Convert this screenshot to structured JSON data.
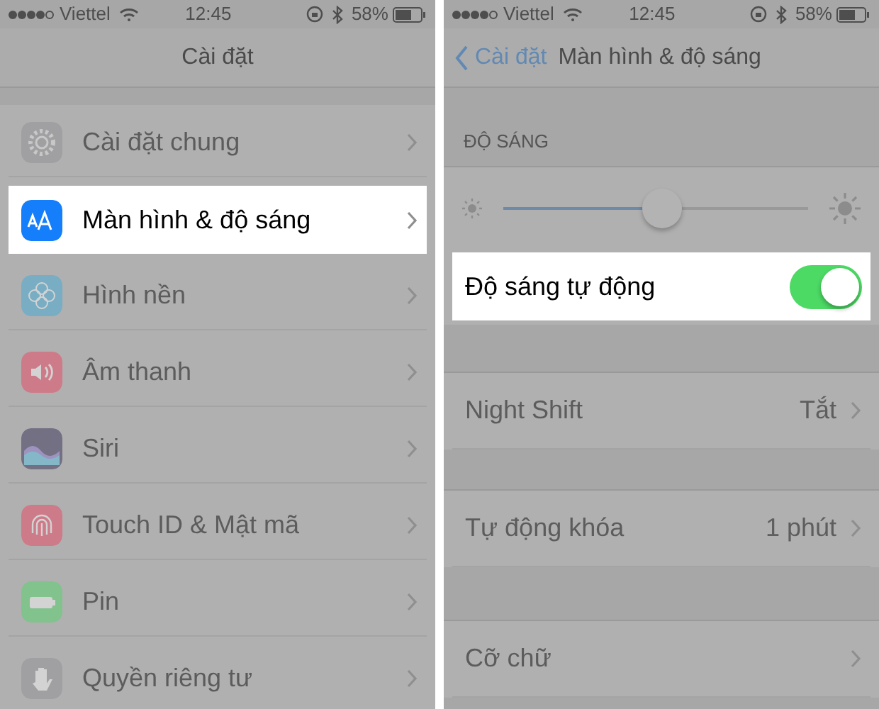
{
  "left": {
    "status_bar": {
      "carrier": "Viettel",
      "time": "12:45",
      "battery": "58%"
    },
    "title": "Cài đặt",
    "items": [
      {
        "label": "Cài đặt chung",
        "highlighted": false
      },
      {
        "label": "Màn hình & độ sáng",
        "highlighted": true
      },
      {
        "label": "Hình nền",
        "highlighted": false
      },
      {
        "label": "Âm thanh",
        "highlighted": false
      },
      {
        "label": "Siri",
        "highlighted": false
      },
      {
        "label": "Touch ID & Mật mã",
        "highlighted": false
      },
      {
        "label": "Pin",
        "highlighted": false
      },
      {
        "label": "Quyền riêng tư",
        "highlighted": false
      }
    ]
  },
  "right": {
    "status_bar": {
      "carrier": "Viettel",
      "time": "12:45",
      "battery": "58%"
    },
    "back": "Cài đặt",
    "title": "Màn hình & độ sáng",
    "section_header": "ĐỘ SÁNG",
    "brightness": {
      "level": 0.52
    },
    "auto_brightness": {
      "label": "Độ sáng tự động",
      "on": true,
      "highlighted": true
    },
    "rows": [
      {
        "label": "Night Shift",
        "value": "Tắt"
      },
      {
        "label": "Tự động khóa",
        "value": "1 phút"
      },
      {
        "label": "Cỡ chữ"
      }
    ]
  }
}
